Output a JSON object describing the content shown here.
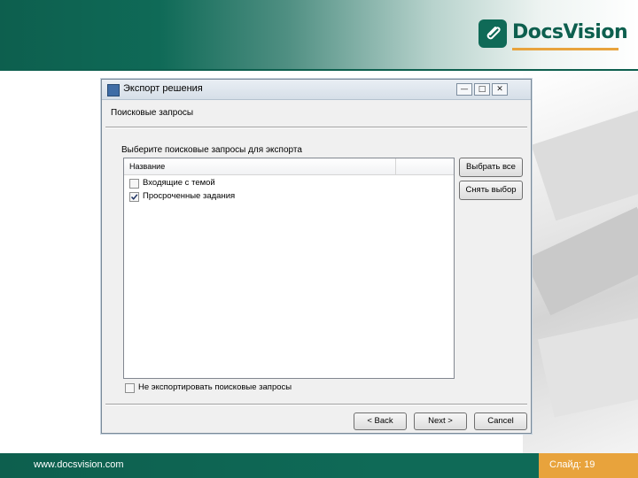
{
  "slide": {
    "logo_text": "DocsVision",
    "url": "www.docsvision.com",
    "slide_number": "Слайд: 19"
  },
  "window": {
    "title": "Экспорт решения",
    "min_glyph": "—",
    "max_glyph": "□",
    "close_glyph": "✕"
  },
  "page": {
    "title": "Поисковые запросы",
    "prompt": "Выберите поисковые запросы для экспорта"
  },
  "list": {
    "column_name": "Название",
    "items": [
      {
        "label": "Входящие с темой",
        "checked": false
      },
      {
        "label": "Просроченные задания",
        "checked": true
      }
    ]
  },
  "side_buttons": {
    "select_all": "Выбрать все",
    "clear_selection": "Снять выбор"
  },
  "no_export": {
    "label": "Не экспортировать поисковые запросы",
    "checked": false
  },
  "footer_buttons": {
    "back": "< Back",
    "next": "Next >",
    "cancel": "Cancel"
  },
  "colors": {
    "brand": "#0d5f4e",
    "accent": "#e8a33c"
  },
  "icons": {
    "logo": "paperclip-icon",
    "app": "window-app-icon",
    "check": "checkmark-icon"
  }
}
